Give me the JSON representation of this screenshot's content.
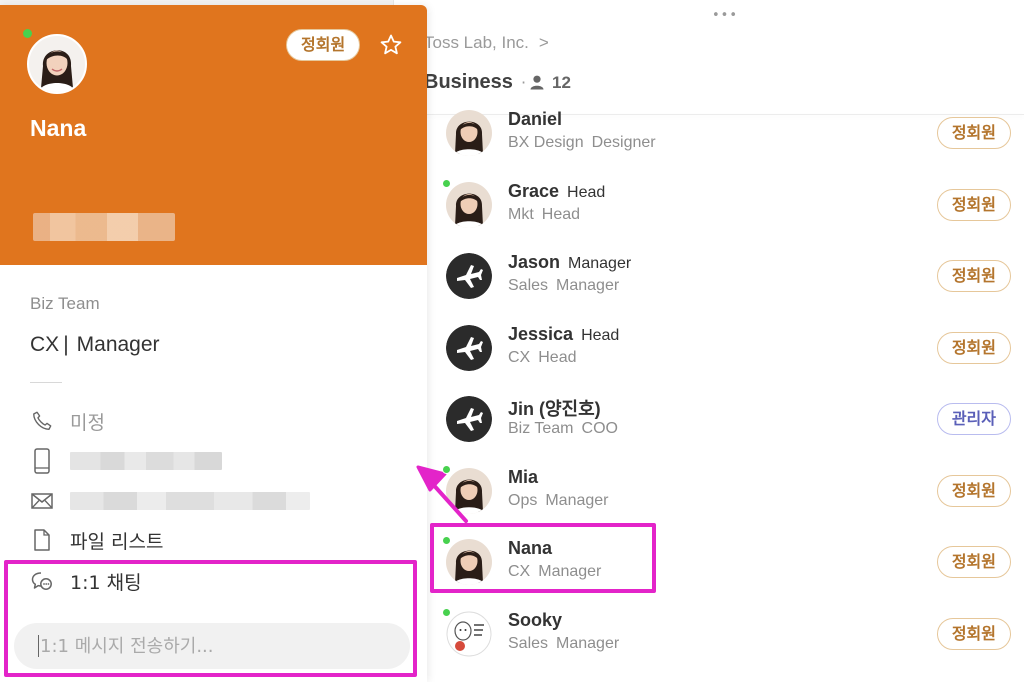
{
  "member_panel": {
    "drag_handle": "•••",
    "breadcrumb": "Toss Lab, Inc.",
    "breadcrumb_chevron": ">",
    "topic_title": "Business",
    "topic_dot": "·",
    "member_count": "12",
    "members": [
      {
        "name": "Daniel",
        "role": "",
        "team": "BX Design",
        "position": "Designer",
        "badge": "정회원",
        "badge_type": "member",
        "online": false,
        "avatar": "person-photo-avatar"
      },
      {
        "name": "Grace",
        "role": "Head",
        "team": "Mkt",
        "position": "Head",
        "badge": "정회원",
        "badge_type": "member",
        "online": true,
        "avatar": "person-photo-avatar"
      },
      {
        "name": "Jason",
        "role": "Manager",
        "team": "Sales",
        "position": "Manager",
        "badge": "정회원",
        "badge_type": "member",
        "online": false,
        "avatar": "airplane-avatar"
      },
      {
        "name": "Jessica",
        "role": "Head",
        "team": "CX",
        "position": "Head",
        "badge": "정회원",
        "badge_type": "member",
        "online": false,
        "avatar": "airplane-avatar"
      },
      {
        "name": "Jin (양진호)",
        "role": "",
        "team": "Biz Team",
        "position": "COO",
        "badge": "관리자",
        "badge_type": "admin",
        "online": false,
        "avatar": "airplane-avatar"
      },
      {
        "name": "Mia",
        "role": "",
        "team": "Ops",
        "position": "Manager",
        "badge": "정회원",
        "badge_type": "member",
        "online": true,
        "avatar": "person-photo-avatar"
      },
      {
        "name": "Nana",
        "role": "",
        "team": "CX",
        "position": "Manager",
        "badge": "정회원",
        "badge_type": "member",
        "online": true,
        "avatar": "person-photo-avatar"
      },
      {
        "name": "Sooky",
        "role": "",
        "team": "Sales",
        "position": "Manager",
        "badge": "정회원",
        "badge_type": "member",
        "online": true,
        "avatar": "illustration-avatar"
      }
    ]
  },
  "profile": {
    "name": "Nana",
    "badge": "정회원",
    "online": true,
    "team": "Biz Team",
    "department": "CX",
    "position": "Manager",
    "phone_status": "미정",
    "file_list_label": "파일 리스트",
    "chat_label": "1:1 채팅",
    "message_placeholder": "1:1 메시지 전송하기..."
  },
  "colors": {
    "header_orange": "#e0751e",
    "badge_member": "#b4752d",
    "badge_admin": "#5a5fb8",
    "online_green": "#47d14e",
    "highlight_magenta": "#e324c9"
  },
  "icons": [
    "star-icon",
    "member-icon",
    "phone-icon",
    "mobile-icon",
    "mail-icon",
    "file-icon",
    "chat-icon"
  ]
}
